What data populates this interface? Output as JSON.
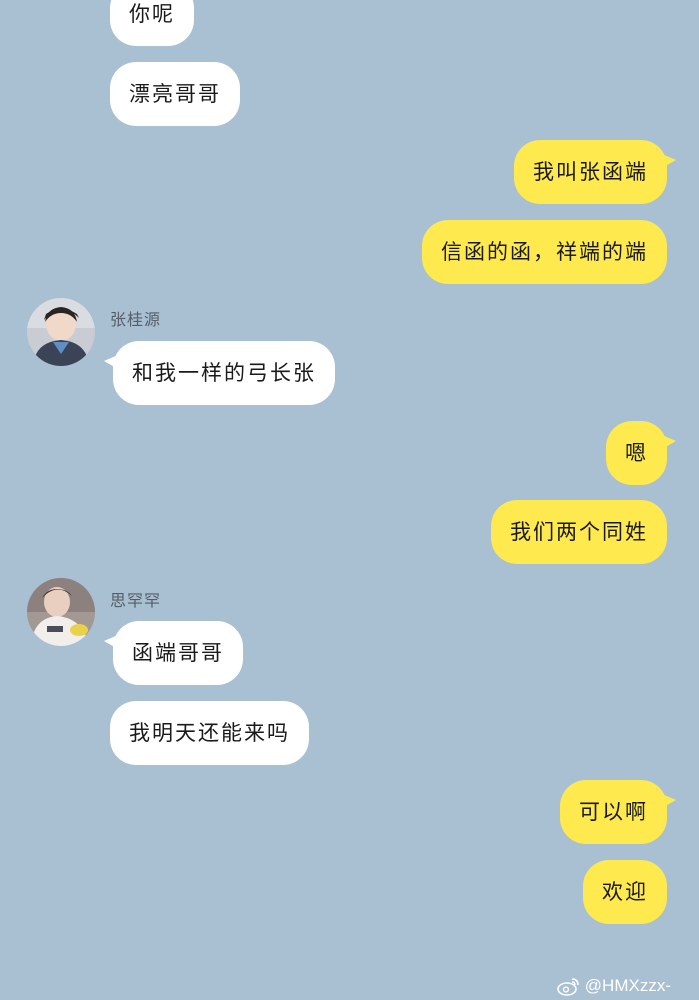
{
  "colors": {
    "background": "#a9bfd2",
    "incoming_bubble": "#ffffff",
    "outgoing_bubble": "#fee94e"
  },
  "messages": [
    {
      "side": "in",
      "text": "你呢"
    },
    {
      "side": "in",
      "text": "漂亮哥哥"
    },
    {
      "side": "out",
      "text": "我叫张函端"
    },
    {
      "side": "out",
      "text": "信函的函，祥端的端"
    },
    {
      "side": "in",
      "sender": "张桂源",
      "text": "和我一样的弓长张"
    },
    {
      "side": "out",
      "text": "嗯"
    },
    {
      "side": "out",
      "text": "我们两个同姓"
    },
    {
      "side": "in",
      "sender": "思罕罕",
      "text": "函端哥哥"
    },
    {
      "side": "in",
      "text": "我明天还能来吗"
    },
    {
      "side": "out",
      "text": "可以啊"
    },
    {
      "side": "out",
      "text": "欢迎"
    }
  ],
  "watermark": "@HMXzzx-"
}
